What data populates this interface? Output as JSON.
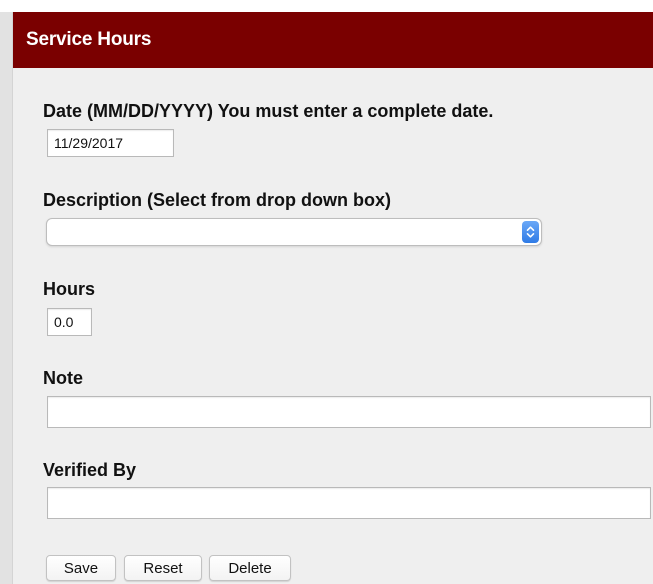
{
  "header": {
    "title": "Service Hours"
  },
  "form": {
    "date": {
      "label": "Date (MM/DD/YYYY) You must enter a complete date.",
      "value": "11/29/2017"
    },
    "description": {
      "label": "Description (Select from drop down box)",
      "selected": ""
    },
    "hours": {
      "label": "Hours",
      "value": "0.0"
    },
    "note": {
      "label": "Note",
      "value": ""
    },
    "verified_by": {
      "label": "Verified By",
      "value": ""
    }
  },
  "buttons": {
    "save": "Save",
    "reset": "Reset",
    "delete": "Delete"
  },
  "colors": {
    "header_bg": "#7a0000",
    "panel_bg": "#efefef",
    "select_arrow": "#3b86ee"
  },
  "icons": {
    "select_arrow": "chevron-up-down-icon"
  }
}
